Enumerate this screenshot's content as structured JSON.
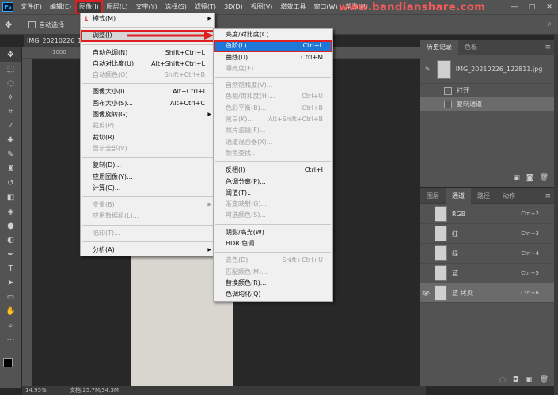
{
  "menubar": {
    "logo": "Ps",
    "items": [
      "文件(F)",
      "编辑(E)",
      "图像(I)",
      "图层(L)",
      "文字(Y)",
      "选择(S)",
      "滤镜(T)",
      "3D(D)",
      "视图(V)",
      "增效工具",
      "窗口(W)",
      "帮助(H)"
    ],
    "watermark": "www.bandianshare.com",
    "win_min": "—",
    "win_max": "□",
    "win_close": "✕"
  },
  "options": {
    "auto_select_label": "自动选择",
    "right_icon": "⌕"
  },
  "document": {
    "tab_title": "IMG_20210226_1",
    "ruler_label": "1000",
    "zoom": "14.95%",
    "doc_info": "文档:25.7M/34.3M"
  },
  "image_menu": {
    "items": [
      {
        "label": "模式(M)",
        "key": "",
        "submenu": true,
        "disabled": false
      },
      {
        "sep": true
      },
      {
        "label": "调整(J)",
        "key": "",
        "submenu": true,
        "disabled": false,
        "highlight": true
      },
      {
        "sep": true
      },
      {
        "label": "自动色调(N)",
        "key": "Shift+Ctrl+L",
        "disabled": false
      },
      {
        "label": "自动对比度(U)",
        "key": "Alt+Shift+Ctrl+L",
        "disabled": false
      },
      {
        "label": "自动颜色(O)",
        "key": "Shift+Ctrl+B",
        "disabled": true
      },
      {
        "sep": true
      },
      {
        "label": "图像大小(I)...",
        "key": "Alt+Ctrl+I",
        "disabled": false
      },
      {
        "label": "画布大小(S)...",
        "key": "Alt+Ctrl+C",
        "disabled": false
      },
      {
        "label": "图像旋转(G)",
        "key": "",
        "submenu": true,
        "disabled": false
      },
      {
        "label": "裁剪(P)",
        "key": "",
        "disabled": true
      },
      {
        "label": "裁切(R)...",
        "key": "",
        "disabled": false
      },
      {
        "label": "显示全部(V)",
        "key": "",
        "disabled": true
      },
      {
        "sep": true
      },
      {
        "label": "复制(D)...",
        "key": "",
        "disabled": false
      },
      {
        "label": "应用图像(Y)...",
        "key": "",
        "disabled": false
      },
      {
        "label": "计算(C)...",
        "key": "",
        "disabled": false
      },
      {
        "sep": true
      },
      {
        "label": "变量(B)",
        "key": "",
        "submenu": true,
        "disabled": true
      },
      {
        "label": "应用数据组(L)...",
        "key": "",
        "disabled": true
      },
      {
        "sep": true
      },
      {
        "label": "陷印(T)...",
        "key": "",
        "disabled": true
      },
      {
        "sep": true
      },
      {
        "label": "分析(A)",
        "key": "",
        "submenu": true,
        "disabled": false
      }
    ]
  },
  "adjust_menu": {
    "items": [
      {
        "label": "亮度/对比度(C)...",
        "key": "",
        "disabled": false
      },
      {
        "label": "色阶(L)...",
        "key": "Ctrl+L",
        "disabled": false,
        "highlight": true
      },
      {
        "label": "曲线(U)...",
        "key": "Ctrl+M",
        "disabled": false
      },
      {
        "label": "曝光度(E)...",
        "key": "",
        "disabled": true
      },
      {
        "sep": true
      },
      {
        "label": "自然饱和度(V)...",
        "key": "",
        "disabled": true
      },
      {
        "label": "色相/饱和度(H)...",
        "key": "Ctrl+U",
        "disabled": true
      },
      {
        "label": "色彩平衡(B)...",
        "key": "Ctrl+B",
        "disabled": true
      },
      {
        "label": "黑白(K)...",
        "key": "Alt+Shift+Ctrl+B",
        "disabled": true
      },
      {
        "label": "照片滤镜(F)...",
        "key": "",
        "disabled": true
      },
      {
        "label": "通道混合器(X)...",
        "key": "",
        "disabled": true
      },
      {
        "label": "颜色查找...",
        "key": "",
        "disabled": true
      },
      {
        "sep": true
      },
      {
        "label": "反相(I)",
        "key": "Ctrl+I",
        "disabled": false
      },
      {
        "label": "色调分离(P)...",
        "key": "",
        "disabled": false
      },
      {
        "label": "阈值(T)...",
        "key": "",
        "disabled": false
      },
      {
        "label": "渐变映射(G)...",
        "key": "",
        "disabled": true
      },
      {
        "label": "可选颜色(S)...",
        "key": "",
        "disabled": true
      },
      {
        "sep": true
      },
      {
        "label": "阴影/高光(W)...",
        "key": "",
        "disabled": false
      },
      {
        "label": "HDR 色调...",
        "key": "",
        "disabled": false
      },
      {
        "sep": true
      },
      {
        "label": "去色(D)",
        "key": "Shift+Ctrl+U",
        "disabled": true
      },
      {
        "label": "匹配颜色(M)...",
        "key": "",
        "disabled": true
      },
      {
        "label": "替换颜色(R)...",
        "key": "",
        "disabled": false
      },
      {
        "label": "色调均化(Q)",
        "key": "",
        "disabled": false
      }
    ]
  },
  "history_panel": {
    "tabs": [
      "历史记录",
      "色板"
    ],
    "snapshot": "IMG_20210226_122811.jpg",
    "states": [
      "打开",
      "复制通道"
    ]
  },
  "channels_panel": {
    "tabs": [
      "图层",
      "通道",
      "路径",
      "动作"
    ],
    "channels": [
      {
        "name": "RGB",
        "key": "Ctrl+2",
        "visible": false,
        "selected": false
      },
      {
        "name": "红",
        "key": "Ctrl+3",
        "visible": false,
        "selected": false
      },
      {
        "name": "绿",
        "key": "Ctrl+4",
        "visible": false,
        "selected": false
      },
      {
        "name": "蓝",
        "key": "Ctrl+5",
        "visible": false,
        "selected": false
      },
      {
        "name": "蓝 拷贝",
        "key": "Ctrl+6",
        "visible": true,
        "selected": true
      }
    ]
  },
  "colors": {
    "highlight_blue": "#1e78d7",
    "annotation_red": "#e02020"
  }
}
